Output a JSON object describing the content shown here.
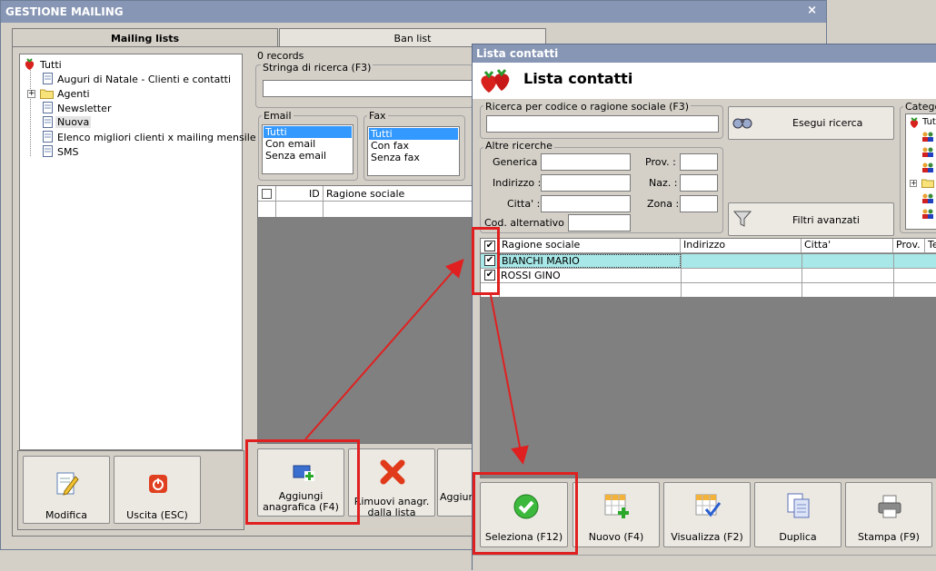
{
  "main_window": {
    "title": "GESTIONE MAILING",
    "close": "×"
  },
  "tabs": [
    {
      "label": "Mailing lists"
    },
    {
      "label": "Ban list"
    }
  ],
  "tree": {
    "root": "Tutti",
    "items": [
      "Auguri di Natale - Clienti e contatti",
      "Agenti",
      "Newsletter",
      "Nuova",
      "Elenco migliori clienti x mailing mensile",
      "SMS"
    ],
    "expander": "+"
  },
  "records": "0 records",
  "search": {
    "label": "Stringa di ricerca (F3)"
  },
  "email": {
    "label": "Email",
    "options": [
      "Tutti",
      "Con email",
      "Senza email"
    ]
  },
  "fax": {
    "label": "Fax",
    "options": [
      "Tutti",
      "Con fax",
      "Senza fax"
    ]
  },
  "left_grid": {
    "columns": [
      "ID",
      "Ragione sociale"
    ]
  },
  "left_buttons": {
    "modifica": "Modifica",
    "uscita": "Uscita (ESC)"
  },
  "mid_buttons": {
    "aggiungi_l1": "Aggiungi",
    "aggiungi_l2": "anagrafica (F4)",
    "rimuovi_l1": "Rimuovi anagr.",
    "rimuovi_l2": "dalla lista",
    "aggiungi2": "Aggiung"
  },
  "contacts_window": {
    "title": "Lista contatti",
    "header": "Lista contatti",
    "search_label": "Ricerca per codice o ragione sociale (F3)",
    "search_button": "Esegui ricerca",
    "other_label": "Altre ricerche",
    "fields": {
      "generica": "Generica :",
      "indirizzo": "Indirizzo :",
      "citta": "Citta' :",
      "cod": "Cod. alternativo :",
      "prov": "Prov. :",
      "naz": "Naz. :",
      "zona": "Zona :"
    },
    "filters_button": "Filtri avanzati",
    "category_label": "Catego",
    "category_root": "Tut",
    "grid": {
      "columns": [
        "Ragione sociale",
        "Indirizzo",
        "Citta'",
        "Prov.",
        "Te"
      ],
      "rows": [
        {
          "name": "BIANCHI MARIO"
        },
        {
          "name": "ROSSI GINO"
        }
      ]
    },
    "buttons": {
      "seleziona": "Seleziona (F12)",
      "nuovo": "Nuovo (F4)",
      "visualizza": "Visualizza (F2)",
      "duplica": "Duplica",
      "stampa": "Stampa (F9)"
    }
  },
  "colors": {
    "annotation": "#e02020",
    "title_bar": "#8796b4",
    "selected_row": "#a8e8e8"
  }
}
